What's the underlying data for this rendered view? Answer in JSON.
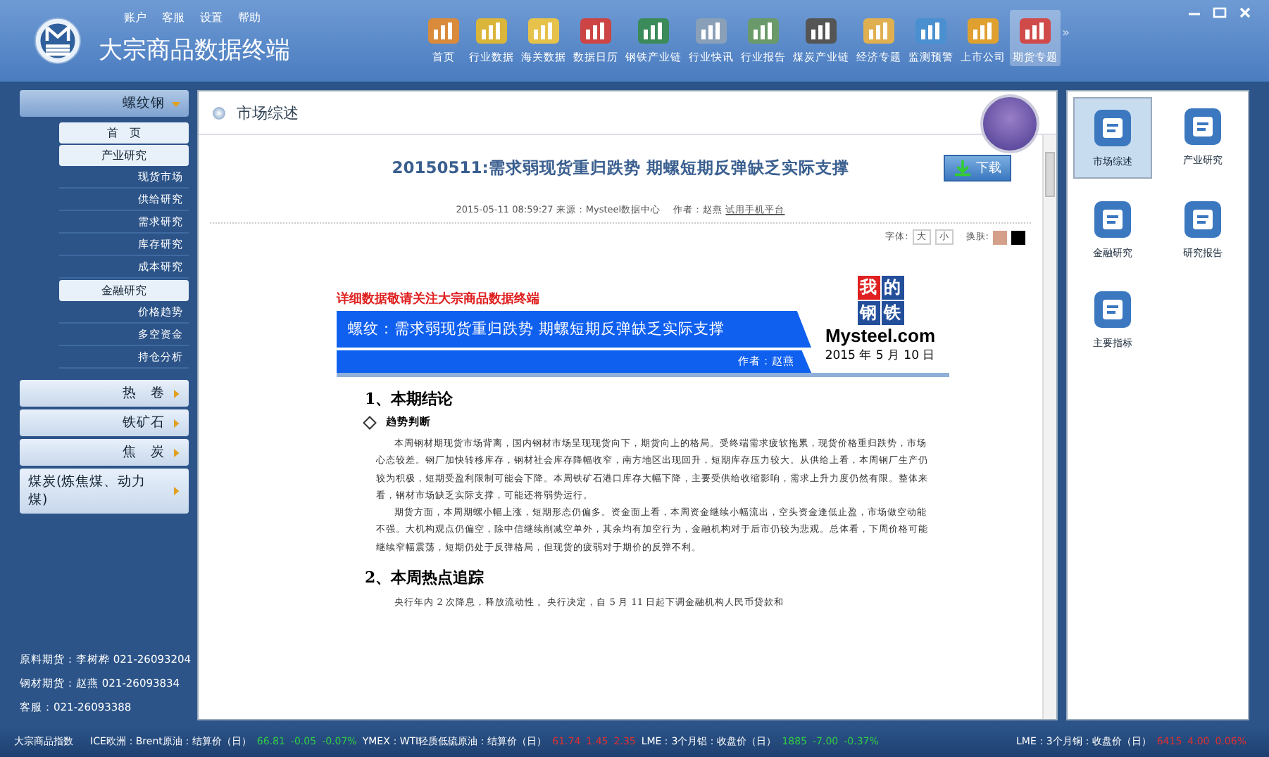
{
  "app": {
    "title": "大宗商品数据终端",
    "menu": [
      "账户",
      "客服",
      "设置",
      "帮助"
    ]
  },
  "nav": [
    {
      "label": "首页",
      "selected": false
    },
    {
      "label": "行业数据",
      "selected": false
    },
    {
      "label": "海关数据",
      "selected": false
    },
    {
      "label": "数据日历",
      "selected": false
    },
    {
      "label": "钢铁产业链",
      "selected": false
    },
    {
      "label": "行业快讯",
      "selected": false
    },
    {
      "label": "行业报告",
      "selected": false
    },
    {
      "label": "煤炭产业链",
      "selected": false
    },
    {
      "label": "经济专题",
      "selected": false
    },
    {
      "label": "监测预警",
      "selected": false
    },
    {
      "label": "上市公司",
      "selected": false
    },
    {
      "label": "期货专题",
      "selected": true
    }
  ],
  "nav_more": "»",
  "sidebar": {
    "sections": [
      {
        "label": "螺纹钢",
        "expanded": true,
        "children": [
          {
            "label": "首　页"
          },
          {
            "label": "产业研究",
            "children": [
              {
                "label": "现货市场"
              },
              {
                "label": "供给研究"
              },
              {
                "label": "需求研究"
              },
              {
                "label": "库存研究"
              },
              {
                "label": "成本研究"
              }
            ]
          },
          {
            "label": "金融研究",
            "children": [
              {
                "label": "价格趋势"
              },
              {
                "label": "多空资金"
              },
              {
                "label": "持仓分析"
              }
            ]
          }
        ]
      },
      {
        "label": "热　卷",
        "expanded": false
      },
      {
        "label": "铁矿石",
        "expanded": false
      },
      {
        "label": "焦　炭",
        "expanded": false
      },
      {
        "label": "煤炭(炼焦煤、动力煤)",
        "expanded": false
      }
    ],
    "contacts": [
      "原料期货：李树桦 021-26093204",
      "钢材期货：赵燕 021-26093834",
      "客服：021-26093388"
    ]
  },
  "panel": {
    "title": "市场综述"
  },
  "article": {
    "title": "20150511:需求弱现货重归跌势 期螺短期反弹缺乏实际支撑",
    "download": "下载",
    "meta": "2015-05-11 08:59:27 来源：Mysteel数据中心　 作者：赵燕",
    "meta_link": "试用手机平台",
    "font_label": "字体:",
    "font_sizes": [
      "大",
      "小"
    ],
    "skin_label": "换肤:",
    "skins": [
      {
        "color": "#d4a08a",
        "selected": false
      },
      {
        "color": "#000000",
        "selected": false
      }
    ],
    "banner": {
      "notice": "详细数据敬请关注大宗商品数据终端",
      "headline": "螺纹：需求弱现货重归跌势  期螺短期反弹缺乏实际支撑",
      "author": "作者：赵燕",
      "logo_chars": [
        "我",
        "的",
        "钢",
        "铁"
      ],
      "logo_text": "Mysteel.com",
      "date": "2015 年 5 月 10 日"
    },
    "sections": [
      {
        "heading": "1、本期结论",
        "subheading": "趋势判断",
        "paragraphs": [
          "本周钢材期现货市场背离，国内钢材市场呈现现货向下，期货向上的格局。受终端需求疲软拖累，现货价格重归跌势，市场心态较差。钢厂加快转移库存，钢材社会库存降幅收窄，南方地区出现回升，短期库存压力较大。从供给上看，本周钢厂生产仍较为积极，短期受盈利限制可能会下降。本周铁矿石港口库存大幅下降，主要受供给收缩影响，需求上升力度仍然有限。整体来看，钢材市场缺乏实际支撑，可能还将弱势运行。",
          "期货方面，本周期螺小幅上涨，短期形态仍偏多。资金面上看，本周资金继续小幅流出，空头资金逢低止盈，市场做空动能不强。大机构观点仍偏空，除中信继续削减空单外，其余均有加空行为，金融机构对于后市仍较为悲观。总体看，下周价格可能继续窄幅震荡，短期仍处于反弹格局，但现货的疲弱对于期价的反弹不利。"
        ]
      },
      {
        "heading": "2、本周热点追踪",
        "paragraphs": [
          "央行年内 2 次降息，释放流动性 。央行决定，自 5 月 11 日起下调金融机构人民币贷款和"
        ]
      }
    ]
  },
  "side_tools": [
    {
      "label": "市场综述",
      "selected": true
    },
    {
      "label": "产业研究",
      "selected": false
    },
    {
      "label": "金融研究",
      "selected": false
    },
    {
      "label": "研究报告",
      "selected": false
    },
    {
      "label": "主要指标",
      "selected": false
    }
  ],
  "ticker": {
    "title": "大宗商品指数",
    "items": [
      {
        "label": "ICE欧洲：Brent原油：结算价（日）",
        "color": "#33cc44",
        "values": [
          "66.81",
          "-0.05",
          "-0.07%"
        ]
      },
      {
        "label": "YMEX：WTI轻质低硫原油：结算价（日）",
        "color": "#e03030",
        "values": [
          "61.74",
          "1.45",
          "2.35"
        ]
      },
      {
        "label": "LME：3个月铝：收盘价（日）",
        "color": "#33cc44",
        "values": [
          "1885",
          "-7.00",
          "-0.37%"
        ]
      },
      {
        "label": "LME：3个月铜：收盘价（日）",
        "color": "#e03030",
        "values": [
          "6415",
          "4.00",
          "0.06%"
        ]
      }
    ]
  }
}
